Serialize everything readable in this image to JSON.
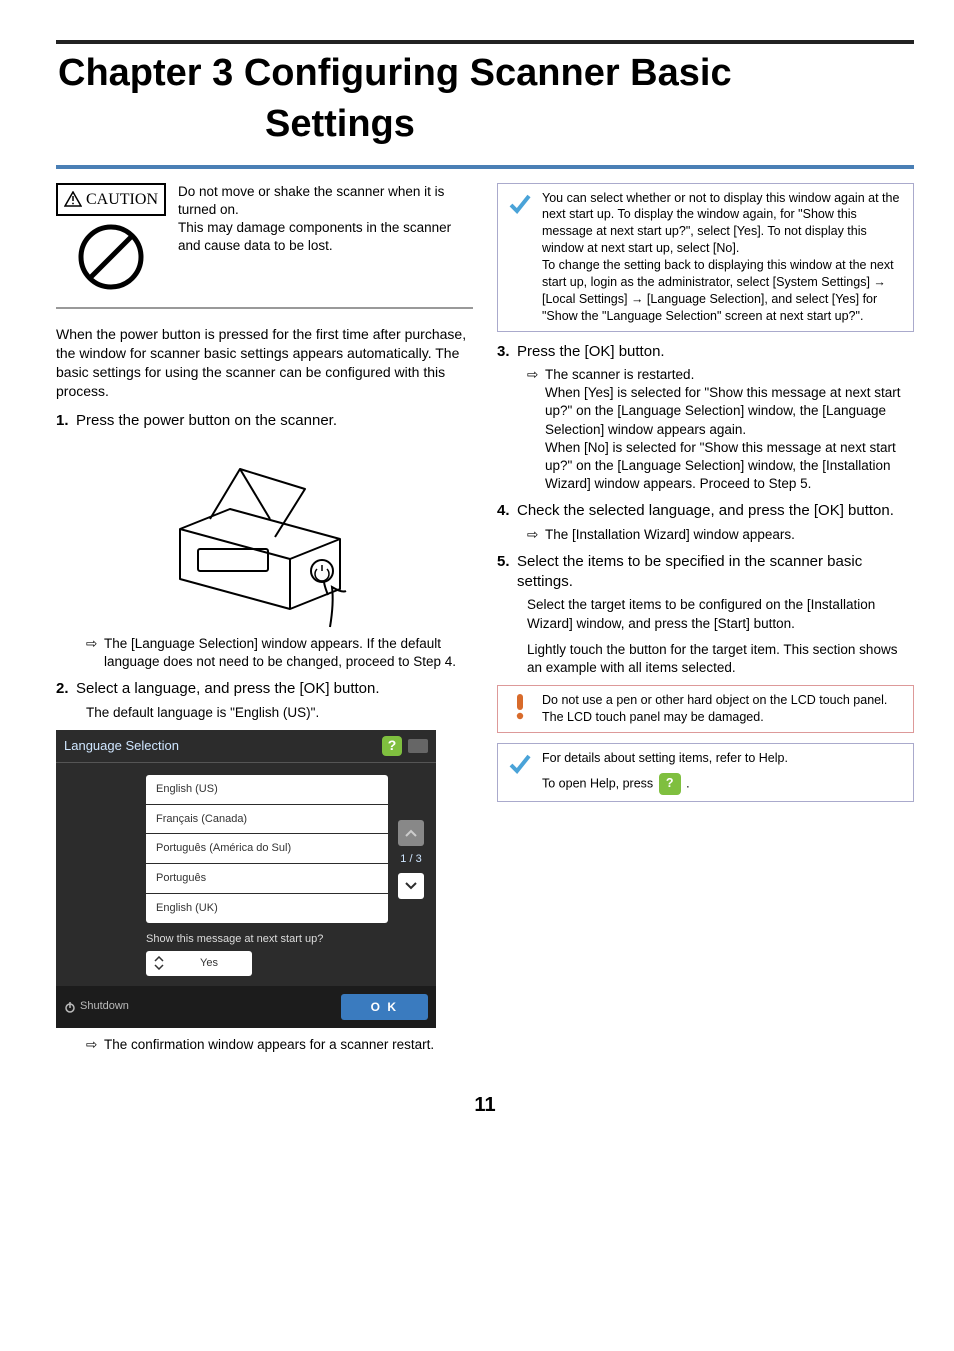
{
  "chapter": {
    "line1": "Chapter 3  Configuring Scanner Basic",
    "line2": "Settings"
  },
  "caution": {
    "label": "CAUTION",
    "text": "Do not move or shake the scanner when it is turned on.\nThis may damage components in the scanner and cause data to be lost."
  },
  "intro": "When the power button is pressed for the first time after purchase, the window for scanner basic settings appears automatically. The basic settings for using the scanner can be configured with this process.",
  "steps": {
    "s1": {
      "num": "1.",
      "text": "Press the power button on the scanner.",
      "result": "The [Language Selection] window appears. If the default language does not need to be changed, proceed to Step 4."
    },
    "s2": {
      "num": "2.",
      "text": "Select a language, and press the [OK] button.",
      "note": "The default language is \"English (US)\".",
      "result": "The confirmation window appears for a scanner restart."
    },
    "s3": {
      "num": "3.",
      "text": "Press the [OK] button.",
      "result_lead": "The scanner is restarted.",
      "result_p1": "When [Yes] is selected for \"Show this message at next start up?\" on the [Language Selection] window, the [Language Selection] window appears again.",
      "result_p2": "When [No] is selected for \"Show this message at next start up?\" on the [Language Selection] window, the [Installation Wizard] window appears. Proceed to Step 5."
    },
    "s4": {
      "num": "4.",
      "text": "Check the selected language, and press the [OK] button.",
      "result": "The [Installation Wizard] window appears."
    },
    "s5": {
      "num": "5.",
      "text": "Select the items to be specified in the scanner basic settings.",
      "p1": "Select the target items to be configured on the [Installation Wizard] window, and press the [Start] button.",
      "p2": "Lightly touch the button for the target item. This section shows an example with all items selected."
    }
  },
  "langScreen": {
    "title": "Language Selection",
    "items": [
      "English (US)",
      "Français (Canada)",
      "Português (América do Sul)",
      "Português",
      "English (UK)"
    ],
    "page": "1 / 3",
    "showLabel": "Show this message at next start up?",
    "showValue": "Yes",
    "shutdown": "Shutdown",
    "ok": "O K"
  },
  "tipBox": {
    "p1": "You can select whether or not to display this window again at the next start up. To display the window again, for \"Show this message at next start up?\", select [Yes]. To not display this window at next start up, select [No].",
    "p2": "To change the setting back to displaying this window at the next start up, login as the administrator, select [System Settings] → [Local Settings] → [Language Selection], and select [Yes] for \"Show the \"Language Selection\" screen at next start up?\"."
  },
  "alert": "Do not use a pen or other hard object on the LCD touch panel. The LCD touch panel may be damaged.",
  "helpNote": {
    "p1": "For details about setting items, refer to Help.",
    "p2a": "To open Help, press ",
    "p2b": " ."
  },
  "pageNumber": "11"
}
